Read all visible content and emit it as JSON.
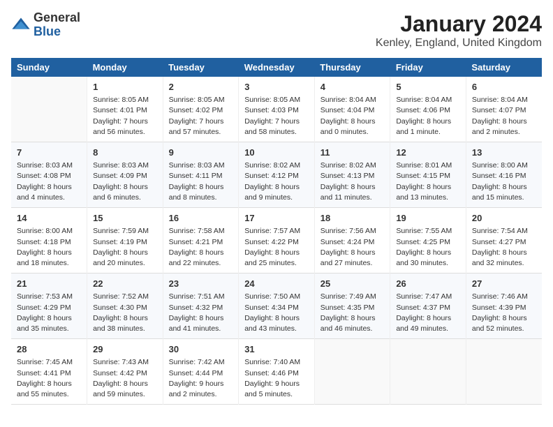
{
  "logo": {
    "general": "General",
    "blue": "Blue"
  },
  "title": "January 2024",
  "subtitle": "Kenley, England, United Kingdom",
  "days_of_week": [
    "Sunday",
    "Monday",
    "Tuesday",
    "Wednesday",
    "Thursday",
    "Friday",
    "Saturday"
  ],
  "weeks": [
    [
      {
        "day": "",
        "info": ""
      },
      {
        "day": "1",
        "info": "Sunrise: 8:05 AM\nSunset: 4:01 PM\nDaylight: 7 hours\nand 56 minutes."
      },
      {
        "day": "2",
        "info": "Sunrise: 8:05 AM\nSunset: 4:02 PM\nDaylight: 7 hours\nand 57 minutes."
      },
      {
        "day": "3",
        "info": "Sunrise: 8:05 AM\nSunset: 4:03 PM\nDaylight: 7 hours\nand 58 minutes."
      },
      {
        "day": "4",
        "info": "Sunrise: 8:04 AM\nSunset: 4:04 PM\nDaylight: 8 hours\nand 0 minutes."
      },
      {
        "day": "5",
        "info": "Sunrise: 8:04 AM\nSunset: 4:06 PM\nDaylight: 8 hours\nand 1 minute."
      },
      {
        "day": "6",
        "info": "Sunrise: 8:04 AM\nSunset: 4:07 PM\nDaylight: 8 hours\nand 2 minutes."
      }
    ],
    [
      {
        "day": "7",
        "info": "Sunrise: 8:03 AM\nSunset: 4:08 PM\nDaylight: 8 hours\nand 4 minutes."
      },
      {
        "day": "8",
        "info": "Sunrise: 8:03 AM\nSunset: 4:09 PM\nDaylight: 8 hours\nand 6 minutes."
      },
      {
        "day": "9",
        "info": "Sunrise: 8:03 AM\nSunset: 4:11 PM\nDaylight: 8 hours\nand 8 minutes."
      },
      {
        "day": "10",
        "info": "Sunrise: 8:02 AM\nSunset: 4:12 PM\nDaylight: 8 hours\nand 9 minutes."
      },
      {
        "day": "11",
        "info": "Sunrise: 8:02 AM\nSunset: 4:13 PM\nDaylight: 8 hours\nand 11 minutes."
      },
      {
        "day": "12",
        "info": "Sunrise: 8:01 AM\nSunset: 4:15 PM\nDaylight: 8 hours\nand 13 minutes."
      },
      {
        "day": "13",
        "info": "Sunrise: 8:00 AM\nSunset: 4:16 PM\nDaylight: 8 hours\nand 15 minutes."
      }
    ],
    [
      {
        "day": "14",
        "info": "Sunrise: 8:00 AM\nSunset: 4:18 PM\nDaylight: 8 hours\nand 18 minutes."
      },
      {
        "day": "15",
        "info": "Sunrise: 7:59 AM\nSunset: 4:19 PM\nDaylight: 8 hours\nand 20 minutes."
      },
      {
        "day": "16",
        "info": "Sunrise: 7:58 AM\nSunset: 4:21 PM\nDaylight: 8 hours\nand 22 minutes."
      },
      {
        "day": "17",
        "info": "Sunrise: 7:57 AM\nSunset: 4:22 PM\nDaylight: 8 hours\nand 25 minutes."
      },
      {
        "day": "18",
        "info": "Sunrise: 7:56 AM\nSunset: 4:24 PM\nDaylight: 8 hours\nand 27 minutes."
      },
      {
        "day": "19",
        "info": "Sunrise: 7:55 AM\nSunset: 4:25 PM\nDaylight: 8 hours\nand 30 minutes."
      },
      {
        "day": "20",
        "info": "Sunrise: 7:54 AM\nSunset: 4:27 PM\nDaylight: 8 hours\nand 32 minutes."
      }
    ],
    [
      {
        "day": "21",
        "info": "Sunrise: 7:53 AM\nSunset: 4:29 PM\nDaylight: 8 hours\nand 35 minutes."
      },
      {
        "day": "22",
        "info": "Sunrise: 7:52 AM\nSunset: 4:30 PM\nDaylight: 8 hours\nand 38 minutes."
      },
      {
        "day": "23",
        "info": "Sunrise: 7:51 AM\nSunset: 4:32 PM\nDaylight: 8 hours\nand 41 minutes."
      },
      {
        "day": "24",
        "info": "Sunrise: 7:50 AM\nSunset: 4:34 PM\nDaylight: 8 hours\nand 43 minutes."
      },
      {
        "day": "25",
        "info": "Sunrise: 7:49 AM\nSunset: 4:35 PM\nDaylight: 8 hours\nand 46 minutes."
      },
      {
        "day": "26",
        "info": "Sunrise: 7:47 AM\nSunset: 4:37 PM\nDaylight: 8 hours\nand 49 minutes."
      },
      {
        "day": "27",
        "info": "Sunrise: 7:46 AM\nSunset: 4:39 PM\nDaylight: 8 hours\nand 52 minutes."
      }
    ],
    [
      {
        "day": "28",
        "info": "Sunrise: 7:45 AM\nSunset: 4:41 PM\nDaylight: 8 hours\nand 55 minutes."
      },
      {
        "day": "29",
        "info": "Sunrise: 7:43 AM\nSunset: 4:42 PM\nDaylight: 8 hours\nand 59 minutes."
      },
      {
        "day": "30",
        "info": "Sunrise: 7:42 AM\nSunset: 4:44 PM\nDaylight: 9 hours\nand 2 minutes."
      },
      {
        "day": "31",
        "info": "Sunrise: 7:40 AM\nSunset: 4:46 PM\nDaylight: 9 hours\nand 5 minutes."
      },
      {
        "day": "",
        "info": ""
      },
      {
        "day": "",
        "info": ""
      },
      {
        "day": "",
        "info": ""
      }
    ]
  ]
}
